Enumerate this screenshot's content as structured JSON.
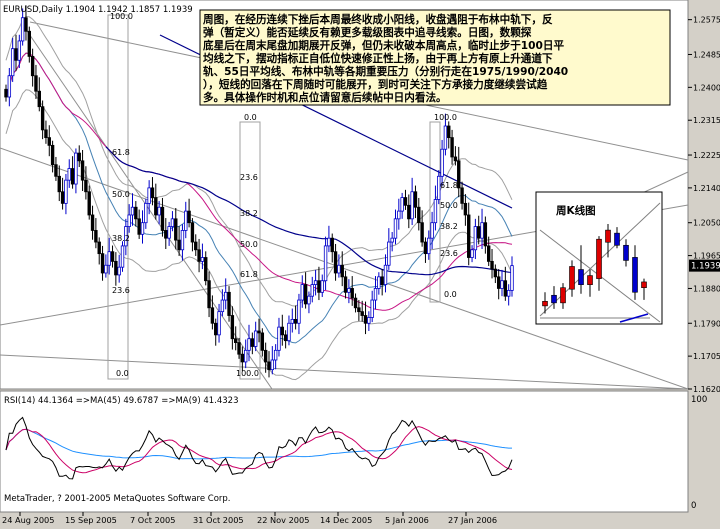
{
  "header": {
    "symbol_info": "EURUSD,Daily  1.1904 1.1942 1.1857 1.1939"
  },
  "annotation": {
    "lines": [
      "周图，在经历连续下挫后本周最终收成小阳线，收盘遇阻于布林中轨下，反",
      "弹（暂定义）能否延续反有赖更多载级图表中追寻线索。日图，数颗探",
      "底星后在周末尾盘加期展开反弹，但仍未收破本周高点，临时止步于100日平",
      "均线之下，摆动指标正自低位快速修正性上扬，由于再上方有原上升通道下",
      "轨、55日平均线、布林中轨等各期重要压力（分别行走在1975/1990/2040",
      "），短线的回落在下周随时可能展开，到时可关注下方承接力度继续尝试趋",
      "多。具体操作时机和点位请留意后续帖中日内看法。"
    ]
  },
  "inset": {
    "title": "周K线图",
    "candles": [
      {
        "o": 1.186,
        "h": 1.1905,
        "l": 1.1835,
        "c": 1.1875
      },
      {
        "o": 1.1895,
        "h": 1.1925,
        "l": 1.185,
        "c": 1.187
      },
      {
        "o": 1.187,
        "h": 1.1935,
        "l": 1.185,
        "c": 1.192
      },
      {
        "o": 1.1915,
        "h": 1.201,
        "l": 1.189,
        "c": 1.199
      },
      {
        "o": 1.198,
        "h": 1.206,
        "l": 1.19,
        "c": 1.193
      },
      {
        "o": 1.193,
        "h": 1.198,
        "l": 1.189,
        "c": 1.196
      },
      {
        "o": 1.195,
        "h": 1.209,
        "l": 1.191,
        "c": 1.208
      },
      {
        "o": 1.207,
        "h": 1.213,
        "l": 1.202,
        "c": 1.211
      },
      {
        "o": 1.21,
        "h": 1.212,
        "l": 1.205,
        "c": 1.206
      },
      {
        "o": 1.206,
        "h": 1.208,
        "l": 1.199,
        "c": 1.201
      },
      {
        "o": 1.202,
        "h": 1.206,
        "l": 1.188,
        "c": 1.1905
      },
      {
        "o": 1.192,
        "h": 1.195,
        "l": 1.188,
        "c": 1.1939
      }
    ]
  },
  "rsi_panel": {
    "label": "RSI(14) 44.1364  =>MA(45) 49.6787  =>MA(9) 41.4323",
    "scale_labels": [
      "100",
      "0"
    ]
  },
  "footer": {
    "copyright": "MetaTrader, ? 2001-2005 MetaQuotes Software Corp."
  },
  "fibo_labels": [
    {
      "id": "fib1-100",
      "text": "100.0"
    },
    {
      "id": "fib1-618",
      "text": "61.8"
    },
    {
      "id": "fib1-500",
      "text": "50.0"
    },
    {
      "id": "fib1-382",
      "text": "38.2"
    },
    {
      "id": "fib1-236",
      "text": "23.6"
    },
    {
      "id": "fib1-00",
      "text": "0.0"
    },
    {
      "id": "fib2-00",
      "text": "0.0"
    },
    {
      "id": "fib2-236",
      "text": "23.6"
    },
    {
      "id": "fib2-382",
      "text": "38.2"
    },
    {
      "id": "fib2-500",
      "text": "50.0"
    },
    {
      "id": "fib2-618",
      "text": "61.8"
    },
    {
      "id": "fib2-100",
      "text": "100.0"
    },
    {
      "id": "fib3-100",
      "text": "100.0"
    },
    {
      "id": "fib3-618",
      "text": "61.8"
    },
    {
      "id": "fib3-500",
      "text": "50.0"
    },
    {
      "id": "fib3-382",
      "text": "38.2"
    },
    {
      "id": "fib3-236",
      "text": "23.6"
    },
    {
      "id": "fib3-00",
      "text": "0.0"
    }
  ],
  "colors": {
    "background": "#d4d0c8",
    "chart_bg": "#ffffff",
    "bull": "#0000cc",
    "bear": "#000000",
    "ma100": "#00008b",
    "ma55": "#c71585",
    "bollinger": "#a0a0a0",
    "mid_band": "#4682b4",
    "rsi": "#000000",
    "rsi_ma45": "#1e90ff",
    "rsi_ma9": "#cc0066",
    "current_price_bg": "#000000",
    "annotation_bg": "#fffacd"
  },
  "chart_data": {
    "type": "candlestick",
    "symbol": "EURUSD",
    "timeframe": "Daily",
    "last_price": "1.1939",
    "ohlc_header": {
      "open": 1.1904,
      "high": 1.1942,
      "low": 1.1857,
      "close": 1.1939
    },
    "x_tick_labels": [
      "24 Aug 2005",
      "15 Sep 2005",
      "7 Oct 2005",
      "31 Oct 2005",
      "22 Nov 2005",
      "14 Dec 2005",
      "5 Jan 2006",
      "27 Jan 2006"
    ],
    "y_tick_labels": [
      "1.2575",
      "1.2485",
      "1.2400",
      "1.2315",
      "1.2225",
      "1.2140",
      "1.2050",
      "1.1965",
      "1.1880",
      "1.1790",
      "1.1705",
      "1.1620"
    ],
    "ylim": [
      1.162,
      1.26
    ],
    "closes": [
      1.2375,
      1.243,
      1.25,
      1.247,
      1.252,
      1.258,
      1.2545,
      1.248,
      1.243,
      1.239,
      1.235,
      1.229,
      1.227,
      1.225,
      1.22,
      1.217,
      1.213,
      1.21,
      1.216,
      1.219,
      1.215,
      1.223,
      1.221,
      1.216,
      1.213,
      1.207,
      1.203,
      1.2,
      1.197,
      1.192,
      1.194,
      1.1975,
      1.195,
      1.1915,
      1.1935,
      1.199,
      1.204,
      1.207,
      1.209,
      1.206,
      1.202,
      1.205,
      1.21,
      1.214,
      1.2115,
      1.207,
      1.209,
      1.203,
      1.201,
      1.204,
      1.206,
      1.2005,
      1.198,
      1.203,
      1.208,
      1.205,
      1.2,
      1.198,
      1.195,
      1.196,
      1.19,
      1.183,
      1.179,
      1.176,
      1.182,
      1.185,
      1.187,
      1.181,
      1.175,
      1.174,
      1.171,
      1.169,
      1.172,
      1.175,
      1.173,
      1.177,
      1.1765,
      1.172,
      1.169,
      1.167,
      1.1695,
      1.172,
      1.178,
      1.176,
      1.1745,
      1.179,
      1.18,
      1.179,
      1.185,
      1.189,
      1.184,
      1.186,
      1.189,
      1.19,
      1.187,
      1.19,
      1.199,
      1.201,
      1.1975,
      1.192,
      1.194,
      1.191,
      1.187,
      1.188,
      1.1855,
      1.183,
      1.182,
      1.181,
      1.179,
      1.1805,
      1.185,
      1.188,
      1.191,
      1.189,
      1.194,
      1.2,
      1.201,
      1.206,
      1.208,
      1.2115,
      1.2095,
      1.206,
      1.213,
      1.209,
      1.205,
      1.2,
      1.197,
      1.201,
      1.205,
      1.211,
      1.217,
      1.224,
      1.23,
      1.227,
      1.222,
      1.221,
      1.214,
      1.21,
      1.207,
      1.196,
      1.198,
      1.204,
      1.201,
      1.205,
      1.199,
      1.195,
      1.193,
      1.191,
      1.188,
      1.19,
      1.186,
      1.1875,
      1.1939
    ]
  }
}
